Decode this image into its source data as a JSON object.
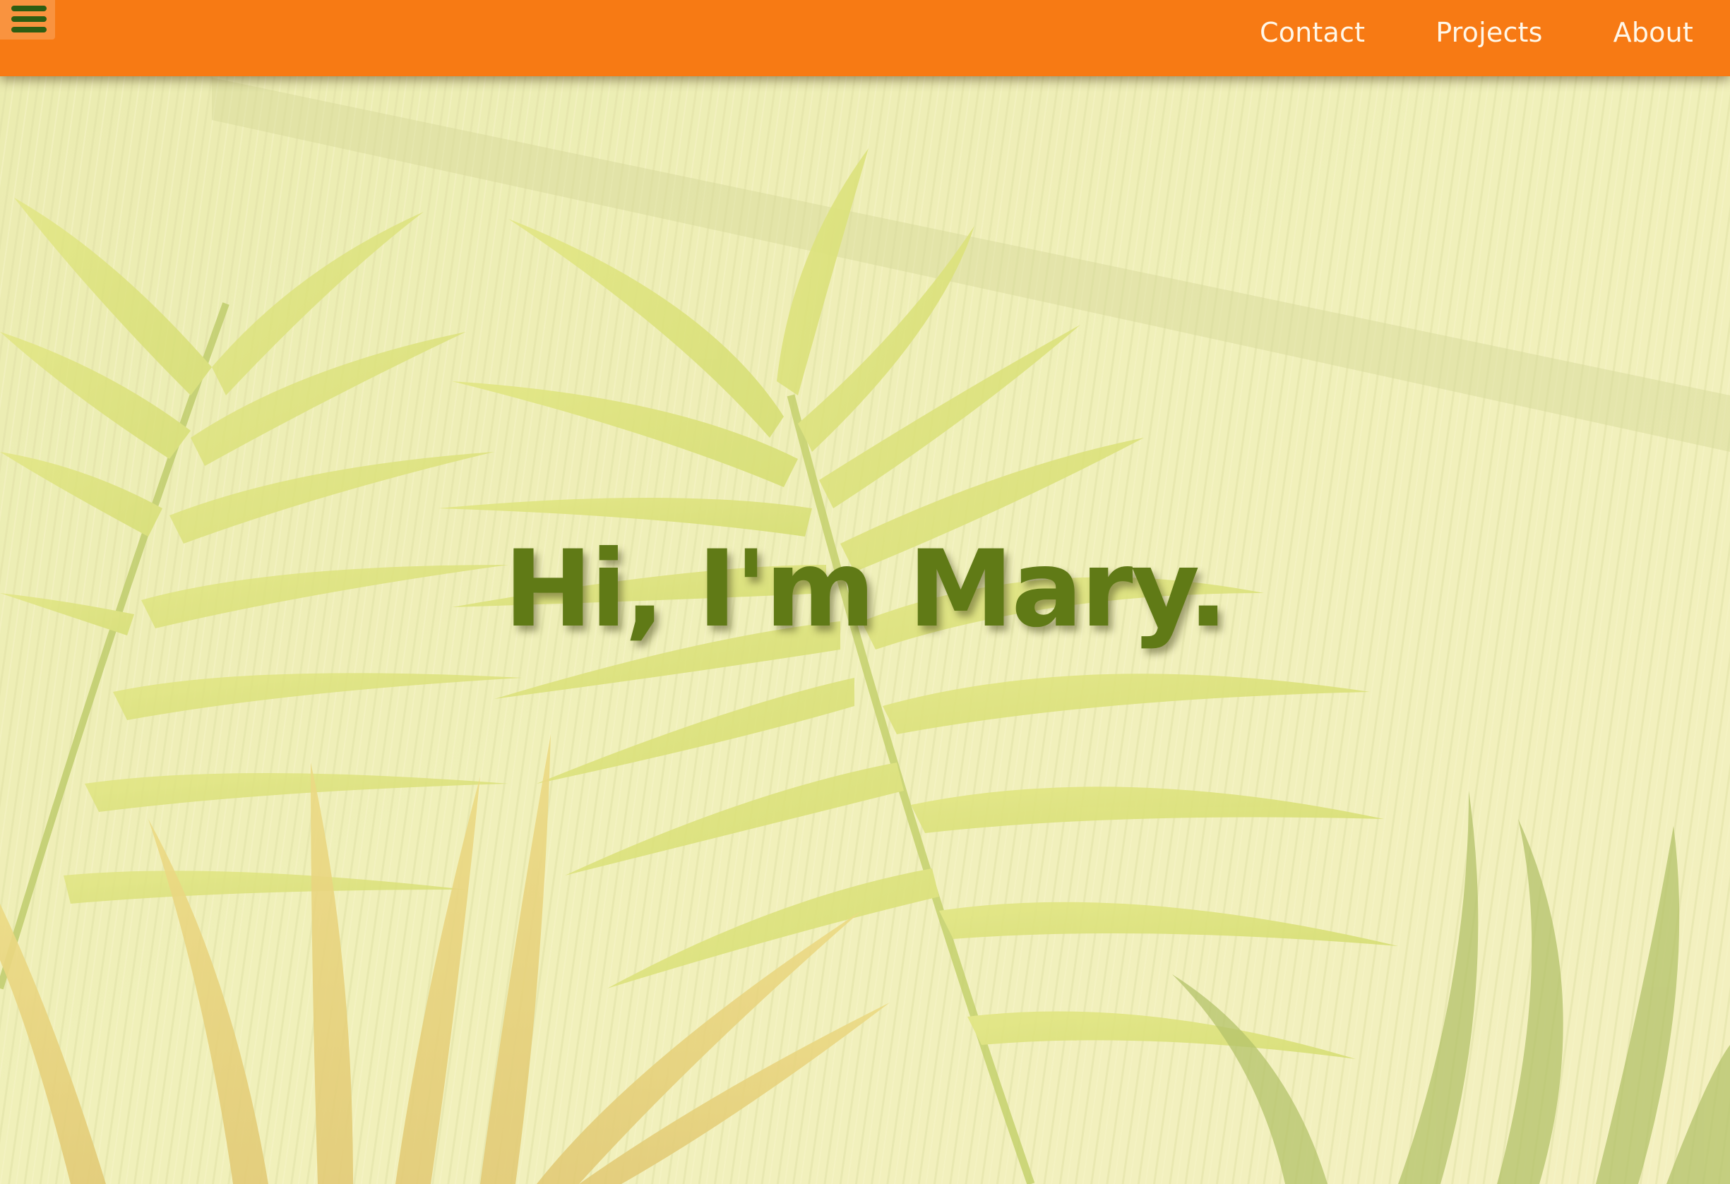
{
  "nav": {
    "menu_icon": "hamburger-menu-icon",
    "links": [
      {
        "label": "Contact"
      },
      {
        "label": "Projects"
      },
      {
        "label": "About"
      }
    ]
  },
  "hero": {
    "headline": "Hi, I'm Mary.",
    "background": "palm-leaves-photo"
  },
  "colors": {
    "nav_bg": "#f77a14",
    "nav_text": "#fff7e8",
    "menu_icon": "#2e5d12",
    "headline": "#607a16",
    "hero_tint": "#e6e8a4"
  }
}
